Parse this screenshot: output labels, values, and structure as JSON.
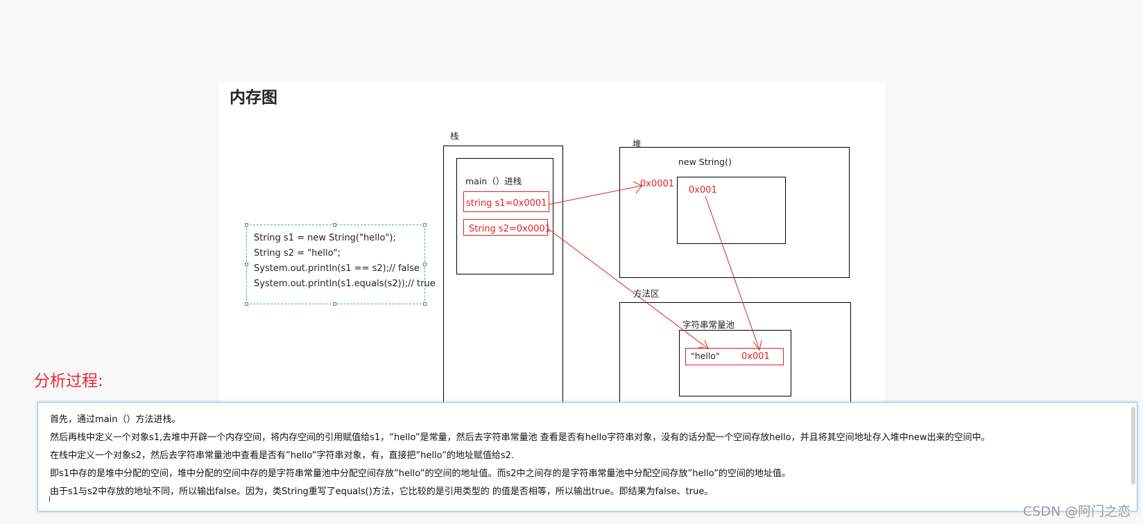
{
  "canvas_title": "内存图",
  "code_lines": [
    "String s1 = new String(\"hello\");",
    "String s2 = \"hello\";",
    "System.out.println(s1 == s2);// false",
    "System.out.println(s1.equals(s2));// true"
  ],
  "stack": {
    "label": "栈",
    "frame_label": "main（）进栈",
    "s1_label": "string   s1=0x0001",
    "s2_label": "String  s2=0x0001"
  },
  "heap": {
    "label": "堆",
    "object_label": "new String()",
    "address_label": "0x0001",
    "inner_value": "0x001"
  },
  "method_area": {
    "label": "方法区",
    "pool_label": "字符串常量池",
    "pool_value": "\"hello\"",
    "pool_address": "0x001"
  },
  "analysis": {
    "title": "分析过程:",
    "paragraphs": [
      "首先，通过main（）方法进栈。",
      "然后再栈中定义一个对象s1,去堆中开辟一个内存空间，将内存空间的引用赋值给s1，“hello”是常量，然后去字符串常量池 查看是否有hello字符串对象，没有的话分配一个空间存放hello，并且将其空间地址存入堆中new出来的空间中。",
      "在栈中定义一个对象s2，然后去字符串常量池中查看是否有”hello”字符串对象，有，直接把”hello”的地址赋值给s2.",
      "即s1中存的是堆中分配的空间，堆中分配的空间中存的是字符串常量池中分配空间存放”hello”的空间的地址值。而s2中之间存的是字符串常量池中分配空间存放”hello”的空间的地址值。",
      "由于s1与s2中存放的地址不同，所以输出false。因为，类String重写了equals()方法，它比较的是引用类型的 的值是否相等，所以输出true。即结果为false、true。"
    ]
  },
  "watermark": "CSDN @阿门之恋",
  "colors": {
    "red": "#e02020",
    "title_red": "#e8242b",
    "selection_blue": "#4d9fe6"
  }
}
